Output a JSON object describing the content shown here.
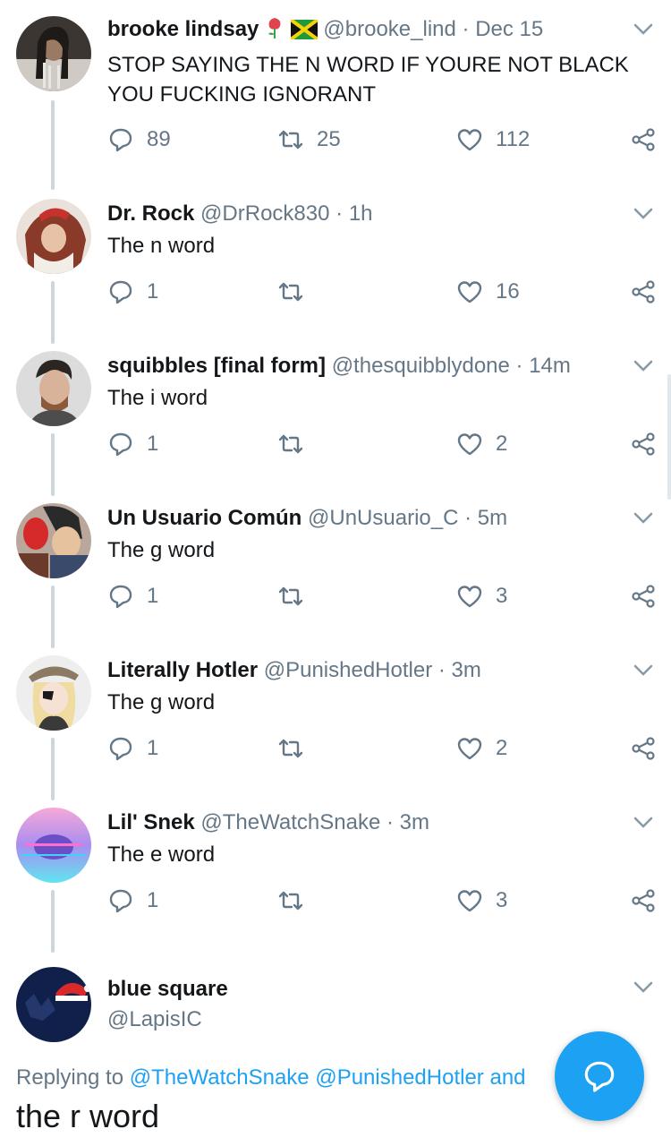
{
  "colors": {
    "accent": "#1da1f2",
    "muted": "#657786",
    "text": "#14171a",
    "line": "#ccd6dd"
  },
  "tweets": [
    {
      "name": "brooke lindsay",
      "name_emoji": [
        "rose-emoji",
        "jamaica-flag-emoji"
      ],
      "handle": "@brooke_lind",
      "time": "Dec 15",
      "text_lines": [
        "STOP SAYING THE N WORD IF YOURE NOT BLACK",
        "YOU FUCKING IGNORANT"
      ],
      "replies": "89",
      "retweets": "25",
      "likes": "112"
    },
    {
      "name": "Dr. Rock",
      "handle": "@DrRock830",
      "time": "1h",
      "text": "The n word",
      "replies": "1",
      "retweets": "",
      "likes": "16"
    },
    {
      "name": "squibbles [final form]",
      "handle": "@thesquibblydone",
      "time": "14m",
      "text": "The i word",
      "replies": "1",
      "retweets": "",
      "likes": "2"
    },
    {
      "name": "Un Usuario Común",
      "handle": "@UnUsuario_C",
      "time": "5m",
      "text": "The g word",
      "replies": "1",
      "retweets": "",
      "likes": "3"
    },
    {
      "name": "Literally Hotler",
      "handle": "@PunishedHotler",
      "time": "3m",
      "text": "The g word",
      "replies": "1",
      "retweets": "",
      "likes": "2"
    },
    {
      "name": "Lil' Snek",
      "handle": "@TheWatchSnake",
      "time": "3m",
      "text": "The e word",
      "replies": "1",
      "retweets": "",
      "likes": "3"
    }
  ],
  "main_tweet": {
    "name": "blue square",
    "handle": "@LapisIC",
    "replying_prefix": "Replying to",
    "replying_mentions": [
      "@TheWatchSnake",
      "@PunishedHotler"
    ],
    "replying_suffix": "and",
    "text": "the r word"
  },
  "fab": {
    "icon": "compose-reply-icon"
  },
  "icons": {
    "reply": "reply-icon",
    "retweet": "retweet-icon",
    "like": "heart-icon",
    "share": "share-icon",
    "caret": "chevron-down-icon"
  }
}
